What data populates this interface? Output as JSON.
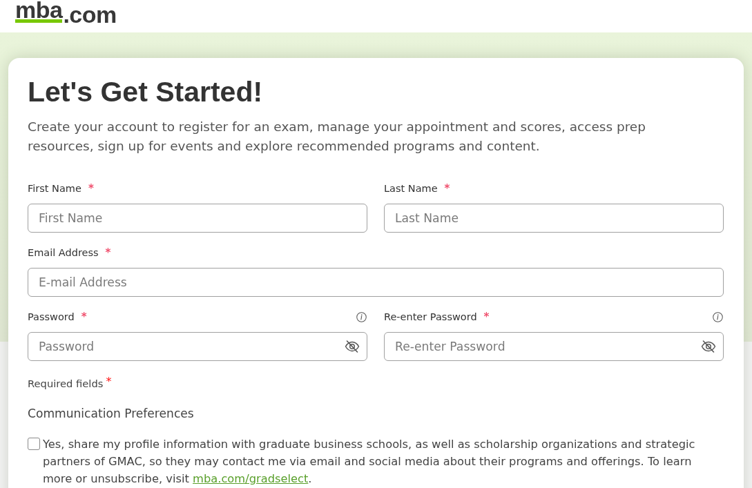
{
  "header": {
    "logo": {
      "primary": "mba",
      "secondary": ".com"
    }
  },
  "form": {
    "title": "Let's Get Started!",
    "intro": "Create your account to register for an exam, manage your appointment and scores, access prep resources, sign up for events and explore recommended programs and content.",
    "rows": [
      [
        {
          "kind": "text",
          "label": "First Name",
          "required_mark": "*",
          "info": false,
          "placeholder": "First Name"
        },
        {
          "kind": "text",
          "label": "Last Name",
          "required_mark": "*",
          "info": false,
          "placeholder": "Last Name"
        }
      ],
      [
        {
          "kind": "text",
          "label": "Email Address",
          "required_mark": "*",
          "info": false,
          "placeholder": "E-mail Address"
        }
      ],
      [
        {
          "kind": "password",
          "label": "Password",
          "required_mark": "*",
          "info": true,
          "placeholder": "Password"
        },
        {
          "kind": "password",
          "label": "Re-enter Password",
          "required_mark": "*",
          "info": true,
          "placeholder": "Re-enter Password"
        }
      ]
    ],
    "required_note": {
      "text": "Required fields",
      "mark": "*"
    },
    "preferences": {
      "heading": "Communication Preferences",
      "consent": {
        "checked": false,
        "text": "Yes, share my profile information with graduate business schools, as well as scholarship organizations and strategic partners of GMAC, so they may contact me via email and social media about their programs and offerings. To learn more or unsubscribe, visit",
        "link": "mba.com/gradselect",
        "after": "."
      }
    }
  }
}
